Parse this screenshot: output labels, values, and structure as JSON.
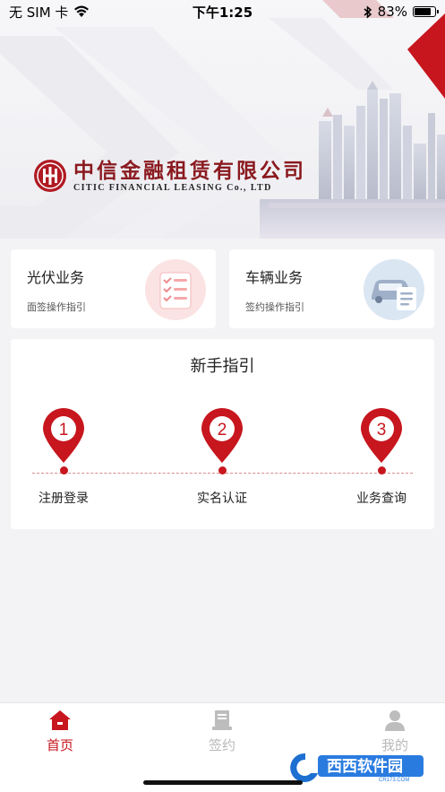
{
  "status_bar": {
    "carrier": "无 SIM 卡",
    "time": "下午1:25",
    "battery": "83%",
    "battery_level": 0.83
  },
  "banner": {
    "company_cn": "中信金融租赁有限公司",
    "company_en": "CITIC FINANCIAL LEASING Co., LTD",
    "accent_color": "#c7161e"
  },
  "services": [
    {
      "title": "光伏业务",
      "subtitle": "面签操作指引",
      "icon": "checklist-icon"
    },
    {
      "title": "车辆业务",
      "subtitle": "签约操作指引",
      "icon": "car-icon"
    }
  ],
  "guide": {
    "title": "新手指引",
    "steps": [
      {
        "number": "1",
        "label": "注册登录"
      },
      {
        "number": "2",
        "label": "实名认证"
      },
      {
        "number": "3",
        "label": "业务查询"
      }
    ]
  },
  "tabbar": {
    "tabs": [
      {
        "label": "首页",
        "icon": "home-icon",
        "active": true
      },
      {
        "label": "签约",
        "icon": "sign-icon",
        "active": false
      },
      {
        "label": "我的",
        "icon": "user-icon",
        "active": false
      }
    ]
  },
  "watermark": {
    "text": "西西软件园",
    "subtext": "CR173.COM"
  }
}
